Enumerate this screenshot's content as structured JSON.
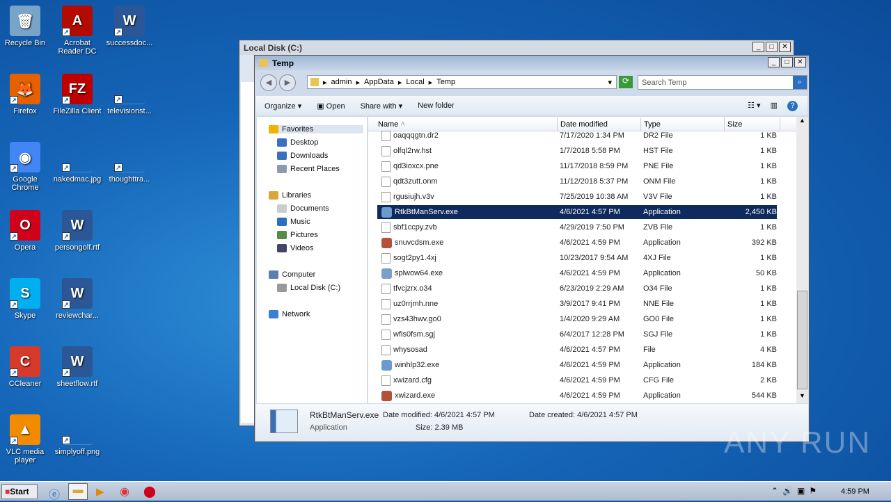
{
  "desktop": {
    "icons": [
      {
        "label": "Recycle Bin",
        "color": "#7aa3c8",
        "glyph": "🗑"
      },
      {
        "label": "Acrobat Reader DC",
        "color": "#b30b00",
        "glyph": "A"
      },
      {
        "label": "successdoc...",
        "color": "#2b5797",
        "glyph": "W"
      },
      {
        "label": "Firefox",
        "color": "#e66000",
        "glyph": "🦊"
      },
      {
        "label": "FileZilla Client",
        "color": "#bf0000",
        "glyph": "FZ"
      },
      {
        "label": "televisionst...",
        "color": "#1a63b5",
        "glyph": ""
      },
      {
        "label": "Google Chrome",
        "color": "#4285f4",
        "glyph": "◉"
      },
      {
        "label": "nakedmac.jpg",
        "color": "#000000",
        "glyph": ""
      },
      {
        "label": "thoughttra...",
        "color": "#1a63b5",
        "glyph": ""
      },
      {
        "label": "Opera",
        "color": "#d0021b",
        "glyph": "O"
      },
      {
        "label": "persongolf.rtf",
        "color": "#2b5797",
        "glyph": "W"
      },
      {
        "label": "Skype",
        "color": "#00aff0",
        "glyph": "S"
      },
      {
        "label": "reviewchar...",
        "color": "#2b5797",
        "glyph": "W"
      },
      {
        "label": "CCleaner",
        "color": "#d63a2a",
        "glyph": "C"
      },
      {
        "label": "sheetflow.rtf",
        "color": "#2b5797",
        "glyph": "W"
      },
      {
        "label": "VLC media player",
        "color": "#f28b00",
        "glyph": "▲"
      },
      {
        "label": "simplyoff.png",
        "color": "#1a63b5",
        "glyph": ""
      }
    ]
  },
  "back_window": {
    "title": "Local Disk (C:)"
  },
  "window": {
    "title": "Temp",
    "breadcrumb": [
      "admin",
      "AppData",
      "Local",
      "Temp"
    ],
    "search_placeholder": "Search Temp",
    "toolbar": {
      "organize": "Organize",
      "open": "Open",
      "share": "Share with",
      "new_folder": "New folder"
    },
    "nav": {
      "favorites": "Favorites",
      "desktop": "Desktop",
      "downloads": "Downloads",
      "recent": "Recent Places",
      "libraries": "Libraries",
      "documents": "Documents",
      "music": "Music",
      "pictures": "Pictures",
      "videos": "Videos",
      "computer": "Computer",
      "local_disk": "Local Disk (C:)",
      "network": "Network"
    },
    "columns": {
      "name": "Name",
      "date": "Date modified",
      "type": "Type",
      "size": "Size"
    },
    "files": [
      {
        "name": "oaqqqgtn.dr2",
        "date": "7/17/2020 1:34 PM",
        "type": "DR2 File",
        "size": "1 KB",
        "icon": "file"
      },
      {
        "name": "olfql2rw.hst",
        "date": "1/7/2018 5:58 PM",
        "type": "HST File",
        "size": "1 KB",
        "icon": "file"
      },
      {
        "name": "qd3ioxcx.pne",
        "date": "11/17/2018 8:59 PM",
        "type": "PNE File",
        "size": "1 KB",
        "icon": "file"
      },
      {
        "name": "qdt3zutt.onm",
        "date": "11/12/2018 5:37 PM",
        "type": "ONM File",
        "size": "1 KB",
        "icon": "file"
      },
      {
        "name": "rgusiujh.v3v",
        "date": "7/25/2019 10:38 AM",
        "type": "V3V File",
        "size": "1 KB",
        "icon": "file"
      },
      {
        "name": "RtkBtManServ.exe",
        "date": "4/6/2021 4:57 PM",
        "type": "Application",
        "size": "2,450 KB",
        "icon": "app",
        "selected": true
      },
      {
        "name": "sbf1ccpy.zvb",
        "date": "4/29/2019 7:50 PM",
        "type": "ZVB File",
        "size": "1 KB",
        "icon": "file"
      },
      {
        "name": "snuvcdsm.exe",
        "date": "4/6/2021 4:59 PM",
        "type": "Application",
        "size": "392 KB",
        "icon": "app"
      },
      {
        "name": "sogt2py1.4xj",
        "date": "10/23/2017 9:54 AM",
        "type": "4XJ File",
        "size": "1 KB",
        "icon": "file"
      },
      {
        "name": "splwow64.exe",
        "date": "4/6/2021 4:59 PM",
        "type": "Application",
        "size": "50 KB",
        "icon": "app"
      },
      {
        "name": "tfvcjzrx.o34",
        "date": "6/23/2019 2:29 AM",
        "type": "O34 File",
        "size": "1 KB",
        "icon": "file"
      },
      {
        "name": "uz0rrjmh.nne",
        "date": "3/9/2017 9:41 PM",
        "type": "NNE File",
        "size": "1 KB",
        "icon": "file"
      },
      {
        "name": "vzs43hwv.go0",
        "date": "1/4/2020 9:29 AM",
        "type": "GO0 File",
        "size": "1 KB",
        "icon": "file"
      },
      {
        "name": "wfis0fsm.sgj",
        "date": "6/4/2017 12:28 PM",
        "type": "SGJ File",
        "size": "1 KB",
        "icon": "file"
      },
      {
        "name": "whysosad",
        "date": "4/6/2021 4:57 PM",
        "type": "File",
        "size": "4 KB",
        "icon": "file"
      },
      {
        "name": "winhlp32.exe",
        "date": "4/6/2021 4:59 PM",
        "type": "Application",
        "size": "184 KB",
        "icon": "app"
      },
      {
        "name": "xwizard.cfg",
        "date": "4/6/2021 4:59 PM",
        "type": "CFG File",
        "size": "2 KB",
        "icon": "file"
      },
      {
        "name": "xwizard.exe",
        "date": "4/6/2021 4:59 PM",
        "type": "Application",
        "size": "544 KB",
        "icon": "app"
      }
    ],
    "details": {
      "name": "RtkBtManServ.exe",
      "type": "Application",
      "modified": "Date modified: 4/6/2021 4:57 PM",
      "created": "Date created: 4/6/2021 4:57 PM",
      "size": "Size: 2.39 MB"
    }
  },
  "taskbar": {
    "start": "Start",
    "clock": "4:59 PM"
  },
  "watermark": "ANY RUN"
}
